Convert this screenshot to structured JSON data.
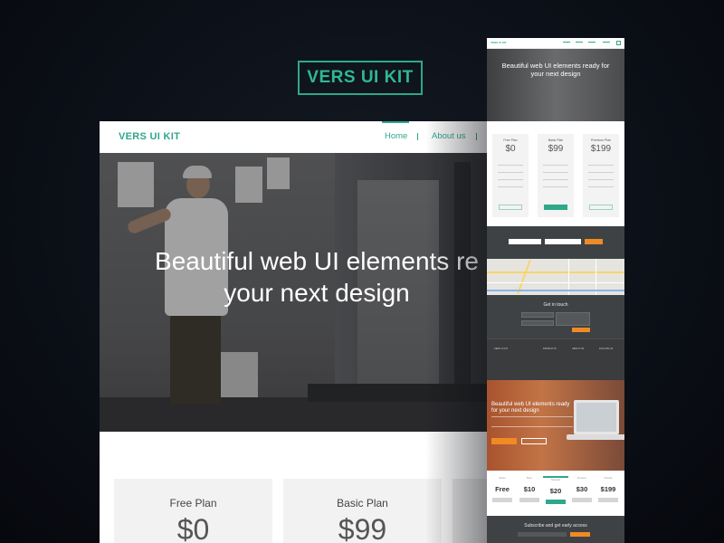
{
  "badge": {
    "label": "VERS UI KIT"
  },
  "main": {
    "nav": {
      "logo": "VERS UI KIT",
      "items": [
        {
          "label": "Home",
          "active": true
        },
        {
          "label": "About us",
          "active": false
        }
      ]
    },
    "hero": {
      "line1": "Beautiful web UI elements re",
      "line2": "your next design"
    },
    "plans": [
      {
        "name": "Free Plan",
        "price": "$0"
      },
      {
        "name": "Basic Plan",
        "price": "$99"
      }
    ]
  },
  "preview": {
    "top": {
      "logo": "VERS UI KIT",
      "hero_line1": "Beautiful web UI elements ready for",
      "hero_line2": "your next design"
    },
    "pricing": [
      {
        "name": "Free Plan",
        "price": "$0"
      },
      {
        "name": "Basic Plan",
        "price": "$99"
      },
      {
        "name": "Premium Plan",
        "price": "$199"
      }
    ],
    "contact": {
      "title": "Get in touch"
    },
    "footer_cols": [
      "VERS UI KIT",
      "PRODUCTS",
      "ABOUT US",
      "FOLLOW US"
    ],
    "landing": {
      "title_line1": "Beautiful web UI elements ready",
      "title_line2": "for your next design"
    },
    "tiers": [
      {
        "price": "Free",
        "label": "Starter"
      },
      {
        "price": "$10",
        "label": "Basic"
      },
      {
        "price": "$20",
        "label": "Standard"
      },
      {
        "price": "$30",
        "label": "Premium"
      },
      {
        "price": "$199",
        "label": "Ultimate"
      }
    ],
    "subscribe": {
      "title": "Subscribe and get early access"
    }
  },
  "colors": {
    "accent": "#2fa88a",
    "orange": "#f08a24",
    "dark": "#3f4244"
  }
}
